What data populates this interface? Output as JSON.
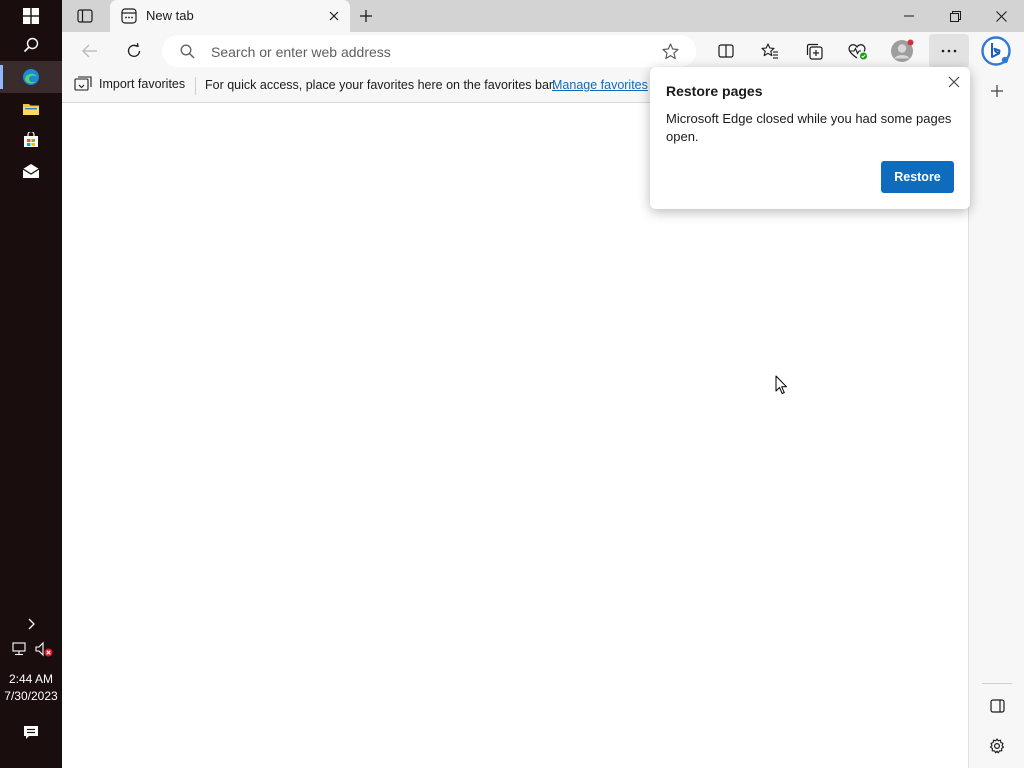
{
  "taskbar": {
    "time": "2:44 AM",
    "date": "7/30/2023"
  },
  "browser": {
    "tab": {
      "title": "New tab"
    },
    "address_bar": {
      "placeholder": "Search or enter web address"
    },
    "favorites_bar": {
      "import_label": "Import favorites",
      "hint_text": "For quick access, place your favorites here on the favorites bar.",
      "manage_link": "Manage favorites"
    }
  },
  "popup": {
    "title": "Restore pages",
    "message": "Microsoft Edge closed while you had some pages open.",
    "restore_label": "Restore"
  },
  "colors": {
    "accent": "#0f6cbd",
    "taskbar_bg": "#1a0d0e",
    "tabstrip_bg": "#d3d3d3"
  }
}
